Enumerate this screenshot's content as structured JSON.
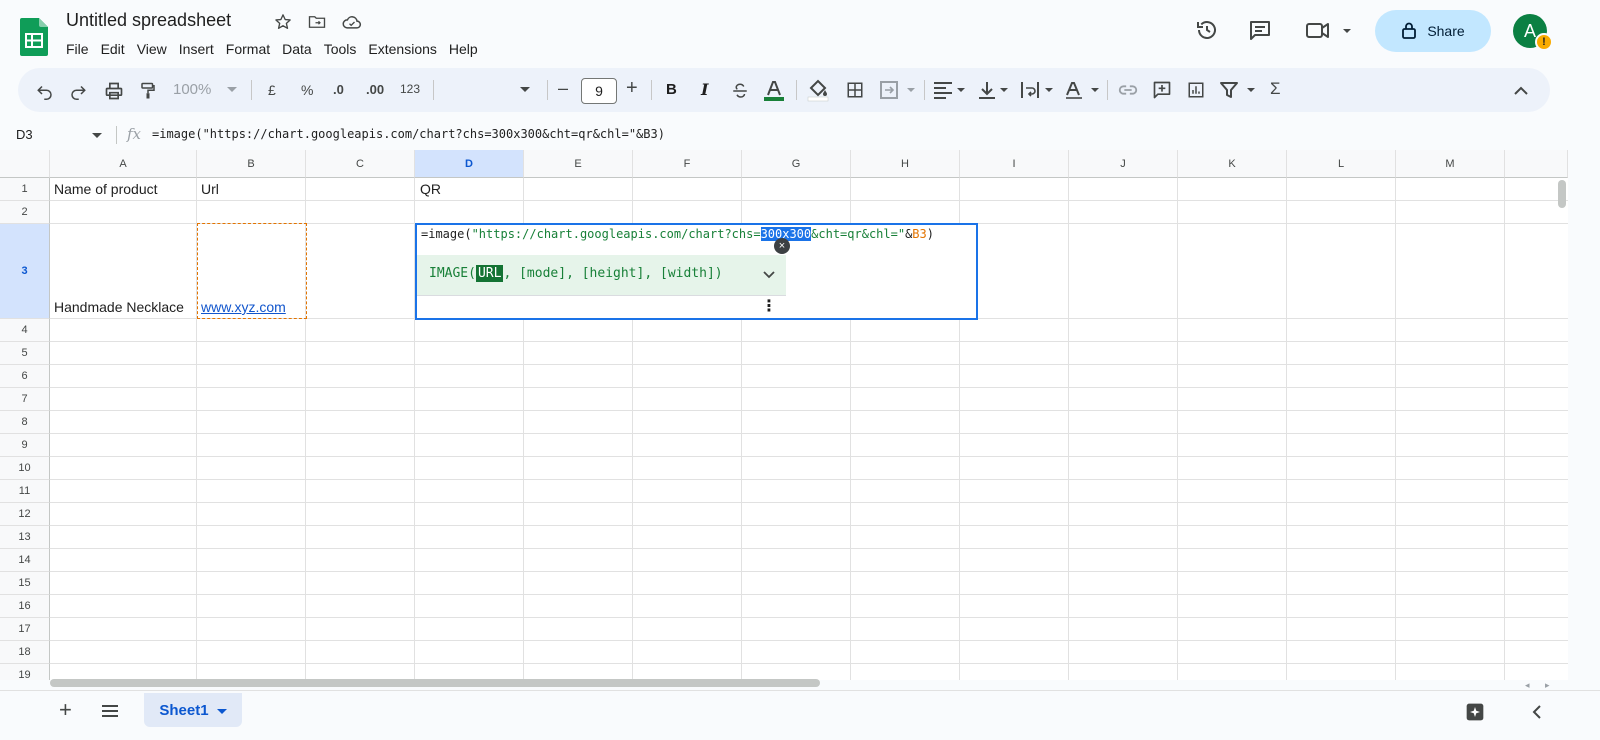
{
  "doc": {
    "title": "Untitled spreadsheet"
  },
  "menu": [
    "File",
    "Edit",
    "View",
    "Insert",
    "Format",
    "Data",
    "Tools",
    "Extensions",
    "Help"
  ],
  "header": {
    "share_label": "Share",
    "avatar_letter": "A",
    "warn_glyph": "!"
  },
  "toolbar": {
    "zoom": "100%",
    "currency": "£",
    "percent": "%",
    "dec_decrease": ".0",
    "dec_increase": ".00",
    "number_format": "123",
    "font_size": "9",
    "minus": "–",
    "plus": "+",
    "bold": "B",
    "italic": "I",
    "sum": "Σ"
  },
  "formula_bar": {
    "cell_ref": "D3",
    "fx": "fx",
    "formula": "=image(\"https://chart.googleapis.com/chart?chs=300x300&cht=qr&chl=\"&B3)"
  },
  "columns": [
    "A",
    "B",
    "C",
    "D",
    "E",
    "F",
    "G",
    "H",
    "I",
    "J",
    "K",
    "L",
    "M"
  ],
  "rows": [
    "1",
    "2",
    "3",
    "4",
    "5",
    "6",
    "7",
    "8",
    "9",
    "10",
    "11",
    "12",
    "13",
    "14",
    "15",
    "16",
    "17",
    "18",
    "19"
  ],
  "cells": {
    "A1": "Name of product",
    "B1": "Url",
    "D1": "QR",
    "A3": "Handmade Necklace",
    "B3": "www.xyz.com"
  },
  "editor": {
    "part1": "=image(",
    "str_a": "\"https://chart.googleapis.com/chart?chs=",
    "str_hl": "300x300",
    "str_b": "&cht=qr&chl=\"",
    "amp": "&",
    "ref": "B3",
    "close": ")"
  },
  "fn_help": {
    "name": "IMAGE(",
    "arg": "URL",
    "rest": ", [mode], [height], [width])",
    "close_glyph": "×",
    "more_glyph": "⋮"
  },
  "sheet": {
    "tab_name": "Sheet1",
    "add_glyph": "+"
  },
  "colors": {
    "accent": "#1a73e8",
    "share_bg": "#c2e7ff",
    "link": "#1155cc",
    "selection": "#d3e3fd"
  }
}
